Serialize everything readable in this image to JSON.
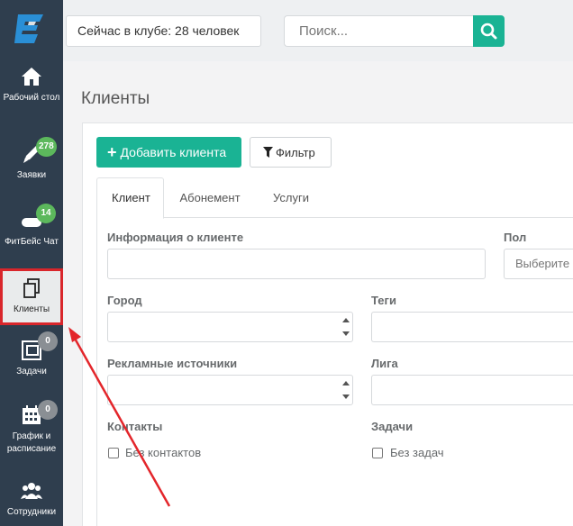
{
  "sidebar": {
    "items": [
      {
        "label": "Рабочий стол",
        "icon": "home-icon"
      },
      {
        "label": "Заявки",
        "icon": "pencil-icon",
        "badge": "278"
      },
      {
        "label": "ФитБейс Чат",
        "icon": "chat-icon",
        "badge": "14"
      },
      {
        "label": "Клиенты",
        "icon": "clients-icon"
      },
      {
        "label": "Задачи",
        "icon": "tasks-icon",
        "badge": "0"
      },
      {
        "label": "График и расписание",
        "icon": "calendar-icon",
        "badge": "0"
      },
      {
        "label": "Сотрудники",
        "icon": "staff-icon"
      }
    ]
  },
  "topbar": {
    "club_status": "Сейчас в клубе: 28 человек",
    "search_placeholder": "Поиск..."
  },
  "page": {
    "title": "Клиенты",
    "add_button": "Добавить клиента",
    "filter_button": "Фильтр"
  },
  "tabs": [
    {
      "label": "Клиент",
      "active": true
    },
    {
      "label": "Абонемент",
      "active": false
    },
    {
      "label": "Услуги",
      "active": false
    }
  ],
  "form": {
    "client_info_label": "Информация о клиенте",
    "gender_label": "Пол",
    "gender_placeholder": "Выберите",
    "city_label": "Город",
    "tags_label": "Теги",
    "ad_sources_label": "Рекламные источники",
    "league_label": "Лига",
    "contacts_label": "Контакты",
    "no_contacts_label": "Без контактов",
    "tasks_label": "Задачи",
    "no_tasks_label": "Без задач"
  },
  "colors": {
    "sidebar_bg": "#2f3e4e",
    "accent": "#1ab394",
    "badge_green": "#5cb85c",
    "highlight_red": "#d9262b"
  }
}
